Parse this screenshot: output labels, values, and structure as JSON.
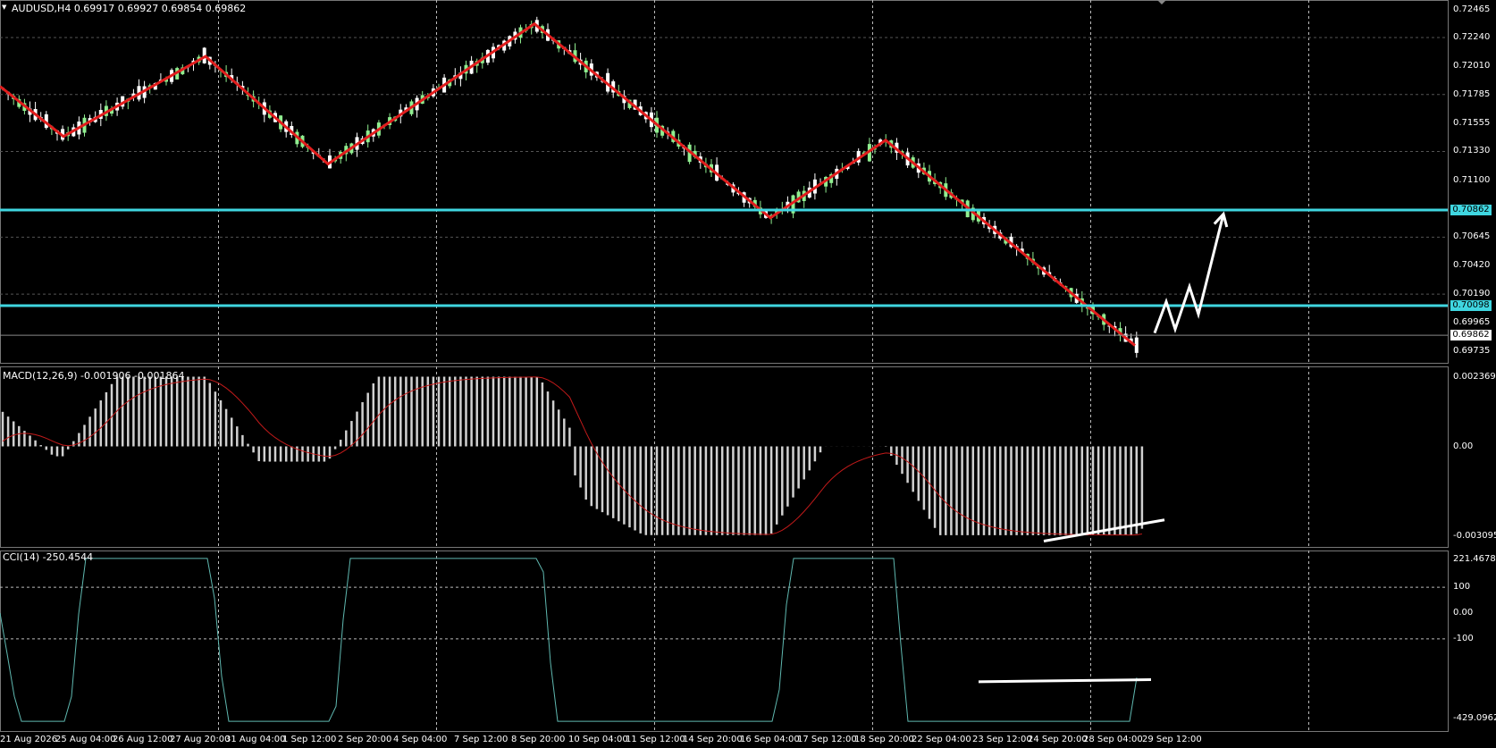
{
  "chart": {
    "title": "AUDUSD,H4  0.69917 0.69927 0.69854 0.69862",
    "symbol": "AUDUSD",
    "timeframe": "H4",
    "background_color": "#000000",
    "bull_candle_color": "#ffffff",
    "bear_candle_color": "#90ee90",
    "zigzag_color": "#e11d1d",
    "level_line_color": "#3fd6e0",
    "grid": true
  },
  "price_axis": {
    "labels": [
      "0.72465",
      "0.72240",
      "0.72010",
      "0.71785",
      "0.71555",
      "0.71330",
      "0.71100",
      "0.70645",
      "0.70420",
      "0.70190",
      "0.69965",
      "0.69735"
    ],
    "range": [
      0.6967,
      0.7254
    ]
  },
  "level_lines": [
    {
      "price": 0.70862,
      "label": "0.70862"
    },
    {
      "price": 0.70098,
      "label": "0.70098"
    }
  ],
  "current_price": {
    "value": 0.69862,
    "label": "0.69862"
  },
  "time_axis": {
    "labels": [
      "21 Aug 2026",
      "25 Aug 04:00",
      "26 Aug 12:00",
      "27 Aug 20:00",
      "31 Aug 04:00",
      "1 Sep 12:00",
      "2 Sep 20:00",
      "4 Sep 04:00",
      "7 Sep 12:00",
      "8 Sep 20:00",
      "10 Sep 04:00",
      "11 Sep 12:00",
      "14 Sep 20:00",
      "16 Sep 04:00",
      "17 Sep 12:00",
      "18 Sep 20:00",
      "22 Sep 04:00",
      "23 Sep 12:00",
      "24 Sep 20:00",
      "28 Sep 04:00",
      "29 Sep 12:00"
    ]
  },
  "zigzag": {
    "points": [
      [
        0,
        0.7185
      ],
      [
        71,
        0.7145
      ],
      [
        230,
        0.7209
      ],
      [
        367,
        0.7123
      ],
      [
        598,
        0.7235
      ],
      [
        862,
        0.708
      ],
      [
        991,
        0.7142
      ],
      [
        1270,
        0.6978
      ]
    ]
  },
  "projection_arrow": {
    "color": "#ffffff",
    "points": [
      [
        1292,
        0.6988
      ],
      [
        1305,
        0.7013
      ],
      [
        1315,
        0.6991
      ],
      [
        1331,
        0.7025
      ],
      [
        1341,
        0.7003
      ],
      [
        1369,
        0.7083
      ]
    ]
  },
  "macd": {
    "label": "MACD(12,26,9) -0.001906 -0.001864",
    "axis_labels": [
      "0.002369",
      "0.00",
      "-0.003095"
    ],
    "range": [
      -0.003095,
      0.002369
    ],
    "histogram_color": "#d0d0d0",
    "signal_color": "#c21a1a",
    "divergence_line": [
      [
        1168,
        -0.00308
      ],
      [
        1303,
        -0.00239
      ]
    ]
  },
  "cci": {
    "label": "CCI(14) -250.4544",
    "axis_labels": [
      "221.4678",
      "100",
      "0.00",
      "-100",
      "-429.0962"
    ],
    "range": [
      -429.0962,
      221.4678
    ],
    "line_color": "#5fb8b0",
    "divergence_line": [
      [
        1095,
        -266
      ],
      [
        1288,
        -258
      ]
    ]
  }
}
